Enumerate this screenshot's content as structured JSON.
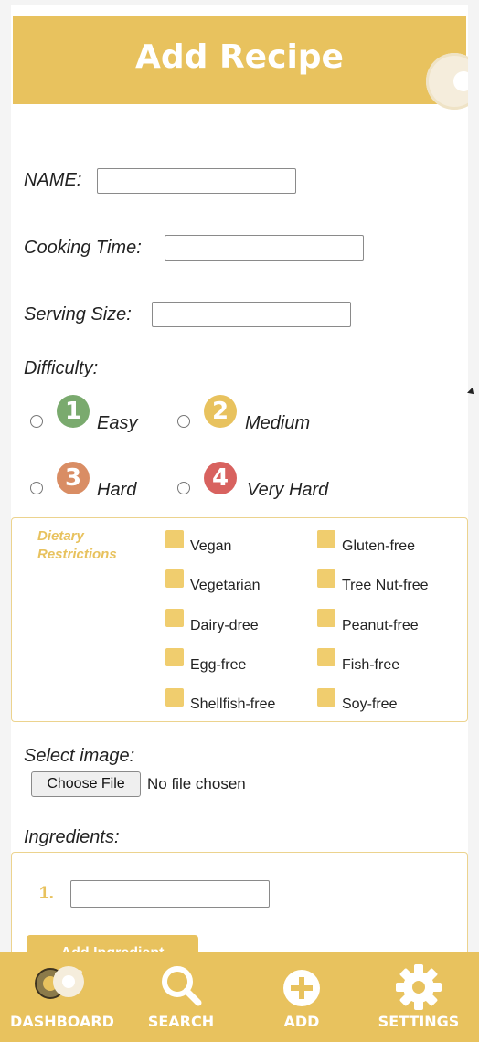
{
  "header": {
    "title": "Add Recipe"
  },
  "form": {
    "name_label": "NAME:",
    "cooking_time_label": "Cooking Time:",
    "serving_size_label": "Serving Size:",
    "difficulty_label": "Difficulty:",
    "difficulty_options": [
      {
        "number": "1",
        "label": "Easy",
        "color": "#7aaa6e"
      },
      {
        "number": "2",
        "label": "Medium",
        "color": "#e8c25e"
      },
      {
        "number": "3",
        "label": "Hard",
        "color": "#d98d64"
      },
      {
        "number": "4",
        "label": "Very Hard",
        "color": "#d8625f"
      }
    ],
    "dietary": {
      "title": "Dietary Restrictions",
      "options": [
        "Vegan",
        "Gluten-free",
        "Vegetarian",
        "Tree Nut-free",
        "Dairy-dree",
        "Peanut-free",
        "Egg-free",
        "Fish-free",
        "Shellfish-free",
        "Soy-free"
      ]
    },
    "select_image_label": "Select image:",
    "choose_file_label": "Choose File",
    "file_status": "No file chosen",
    "ingredients_label": "Ingredients:",
    "ingredient_number": "1.",
    "add_ingredient_label": "Add Ingredient"
  },
  "nav": {
    "items": [
      {
        "label": "DASHBOARD",
        "icon": "donut-icon"
      },
      {
        "label": "SEARCH",
        "icon": "search-icon"
      },
      {
        "label": "ADD",
        "icon": "add-circle-icon"
      },
      {
        "label": "SETTINGS",
        "icon": "gear-icon"
      }
    ]
  },
  "colors": {
    "accent": "#e8c25e",
    "check": "#f0cd6e",
    "border": "#ecd38e"
  }
}
